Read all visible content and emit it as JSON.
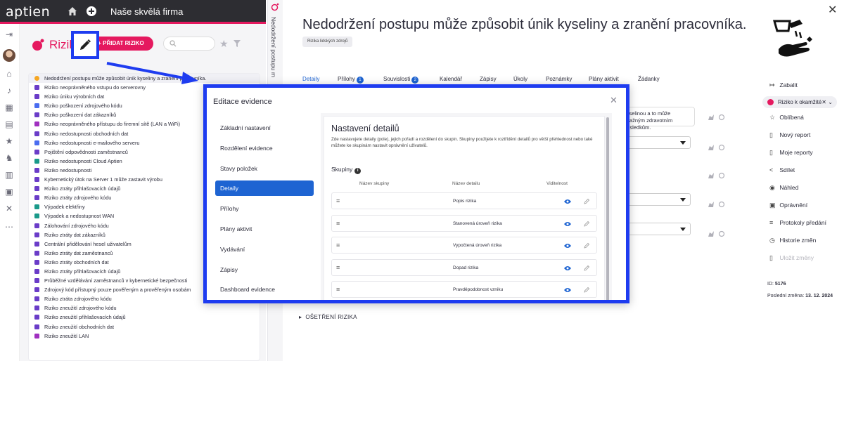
{
  "header": {
    "logo": "aptien",
    "company": "Naše skvělá firma",
    "home_icon": "home-icon",
    "add_icon": "plus-circle-icon"
  },
  "colors": {
    "brand_pink": "#e5195f",
    "accent_blue": "#1e64d2",
    "highlight_blue": "#1e3cf0",
    "topbar": "#2d2d32"
  },
  "list_panel": {
    "title": "Riziko",
    "add_button": "+ PŘIDAT RIZIKO",
    "search_placeholder": "",
    "items": [
      {
        "label": "Nedodržení postupu může způsobit únik kyseliny a zranění pracovníka.",
        "icon": "hazard-icon",
        "color": "#f5a623"
      },
      {
        "label": "Riziko neoprávněného vstupu do serverovny",
        "icon": "door-icon",
        "color": "#6a3cc8"
      },
      {
        "label": "Riziko úniku výrobních dat",
        "icon": "document-icon",
        "color": "#6a3cc8"
      },
      {
        "label": "Riziko poškození zdrojového kódu",
        "icon": "monitor-icon",
        "color": "#4a6cf0"
      },
      {
        "label": "Riziko poškození dat zákazníků",
        "icon": "document-icon",
        "color": "#6a3cc8"
      },
      {
        "label": "Riziko neoprávněného přístupu do firemní sítě (LAN a WiFi)",
        "icon": "network-icon",
        "color": "#a030c0"
      },
      {
        "label": "Riziko nedostupnosti obchodních dat",
        "icon": "document-icon",
        "color": "#6a3cc8"
      },
      {
        "label": "Riziko nedostupnosti e-mailového serveru",
        "icon": "server-icon",
        "color": "#4a6cf0"
      },
      {
        "label": "Pojištění odpovědnosti zaměstnanců",
        "icon": "document-icon",
        "color": "#6a3cc8"
      },
      {
        "label": "Riziko nedostupnosti Cloud Aptien",
        "icon": "cloud-icon",
        "color": "#1a9a8a"
      },
      {
        "label": "Riziko nedostupnosti",
        "icon": "document-icon",
        "color": "#6a3cc8"
      },
      {
        "label": "Kybernetický útok na Server 1 může zastavit výrobu",
        "icon": "document-icon",
        "color": "#6a3cc8"
      },
      {
        "label": "Riziko ztráty přihlašovacích údajů",
        "icon": "document-icon",
        "color": "#6a3cc8"
      },
      {
        "label": "Riziko ztráty zdrojového kódu",
        "icon": "document-icon",
        "color": "#6a3cc8"
      },
      {
        "label": "Výpadek elektřiny",
        "icon": "lock-icon",
        "color": "#1a9a8a"
      },
      {
        "label": "Výpadek a nedostupnost WAN",
        "icon": "lock-icon",
        "color": "#1a9a8a"
      },
      {
        "label": "Zálohování zdrojového kódu",
        "icon": "document-icon",
        "color": "#6a3cc8"
      },
      {
        "label": "Riziko ztráty dat zákazníků",
        "icon": "document-icon",
        "color": "#6a3cc8"
      },
      {
        "label": "Centrální přidělování hesel uživatelům",
        "icon": "document-icon",
        "color": "#6a3cc8"
      },
      {
        "label": "Riziko ztráty dat zaměstnanců",
        "icon": "document-icon",
        "color": "#6a3cc8"
      },
      {
        "label": "Riziko ztráty obchodních dat",
        "icon": "document-icon",
        "color": "#6a3cc8"
      },
      {
        "label": "Riziko ztráty přihlašovacích údajů",
        "icon": "document-icon",
        "color": "#6a3cc8"
      },
      {
        "label": "Průběžné vzdělávání zaměstnanců v kybernetické bezpečnosti",
        "icon": "document-icon",
        "color": "#6a3cc8"
      },
      {
        "label": "Zdrojový kód přístupný pouze pověřeným a prověřeným osobám",
        "icon": "document-icon",
        "color": "#6a3cc8"
      },
      {
        "label": "Riziko ztráta zdrojového kódu",
        "icon": "document-icon",
        "color": "#6a3cc8"
      },
      {
        "label": "Riziko zneužití zdrojového kódu",
        "icon": "document-icon",
        "color": "#6a3cc8"
      },
      {
        "label": "Riziko zneužití přihlašovacích údajů",
        "icon": "document-icon",
        "color": "#6a3cc8"
      },
      {
        "label": "Riziko zneužití obchodních dat",
        "icon": "document-icon",
        "color": "#6a3cc8"
      },
      {
        "label": "Riziko zneužití LAN",
        "icon": "network-icon",
        "color": "#a030c0"
      }
    ]
  },
  "detail": {
    "vertical_title": "Nedodržení postupu m",
    "title": "Nedodržení postupu může způsobit únik kyseliny a zranění pracovníka.",
    "tag": "Rizika lidských zdrojů",
    "tabs": [
      {
        "label": "Detaily",
        "count": ""
      },
      {
        "label": "Přílohy",
        "count": "1"
      },
      {
        "label": "Souvislosti",
        "count": "2"
      },
      {
        "label": "Kalendář",
        "count": ""
      },
      {
        "label": "Zápisy",
        "count": ""
      },
      {
        "label": "Úkoly",
        "count": ""
      },
      {
        "label": "Poznámky",
        "count": ""
      },
      {
        "label": "Plány aktivit",
        "count": ""
      },
      {
        "label": "Žádanky",
        "count": ""
      }
    ],
    "description_partial_line1": "kyselinou a to může",
    "description_partial_line2": "ávažným zdravotním důsledkům.",
    "section_treatment": "OŠETŘENÍ RIZIKA"
  },
  "sidebar": {
    "collapse": "Zabalit",
    "risk_level": "Riziko k okamžité",
    "items": [
      {
        "label": "Oblíbená",
        "icon": "star-icon"
      },
      {
        "label": "Nový report",
        "icon": "report-icon"
      },
      {
        "label": "Moje reporty",
        "icon": "reports-icon"
      },
      {
        "label": "Sdílet",
        "icon": "share-icon"
      },
      {
        "label": "Náhled",
        "icon": "eye-icon"
      },
      {
        "label": "Oprávnění",
        "icon": "permissions-icon"
      },
      {
        "label": "Protokoly předání",
        "icon": "protocol-icon"
      },
      {
        "label": "Historie změn",
        "icon": "history-icon"
      },
      {
        "label": "Uložit změny",
        "icon": "save-icon"
      }
    ],
    "id_label": "ID:",
    "id_value": "5176",
    "last_change_label": "Poslední změna:",
    "last_change_value": "13. 12. 2024"
  },
  "modal": {
    "title": "Editace evidence",
    "nav": [
      "Základní nastavení",
      "Rozdělení evidence",
      "Stavy položek",
      "Detaily",
      "Přílohy",
      "Plány aktivit",
      "Vydávání",
      "Zápisy",
      "Dashboard evidence"
    ],
    "active_nav_index": 3,
    "content_title": "Nastavení detailů",
    "content_description": "Zde nastavujete detaily (pole), jejich pořadí a rozdělení do skupin. Skupiny použijete k roztřídění detailů pro větší přehlednost nebo také můžete ke skupinám nastavit oprávnění uživatelů.",
    "groups_label": "Skupiny",
    "columns": [
      "Název skupiny",
      "Název detailu",
      "Viditelnost"
    ],
    "details": [
      "Popis rizika",
      "Stanovená úroveň rizika",
      "Vypočtená úroveň rizika",
      "Dopad rizika",
      "Pravděpodobnost vzniku"
    ]
  }
}
